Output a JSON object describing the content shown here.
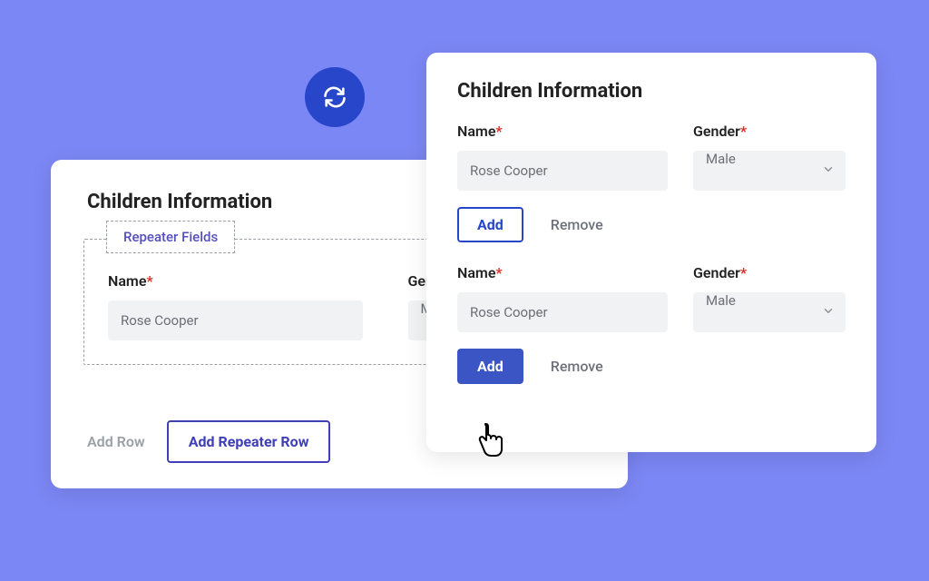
{
  "left_card": {
    "title": "Children Information",
    "repeater_tag": "Repeater Fields",
    "name_label": "Name",
    "gender_label": "Gender",
    "name_value": "Rose Cooper",
    "gender_value": "Male",
    "add_row": "Add Row",
    "add_repeater_row": "Add Repeater Row"
  },
  "right_card": {
    "title": "Children Information",
    "name_label": "Name",
    "gender_label": "Gender",
    "rows": [
      {
        "name": "Rose Cooper",
        "gender": "Male",
        "add": "Add",
        "remove": "Remove",
        "add_variant": "outline"
      },
      {
        "name": "Rose Cooper",
        "gender": "Male",
        "add": "Add",
        "remove": "Remove",
        "add_variant": "solid"
      }
    ]
  }
}
